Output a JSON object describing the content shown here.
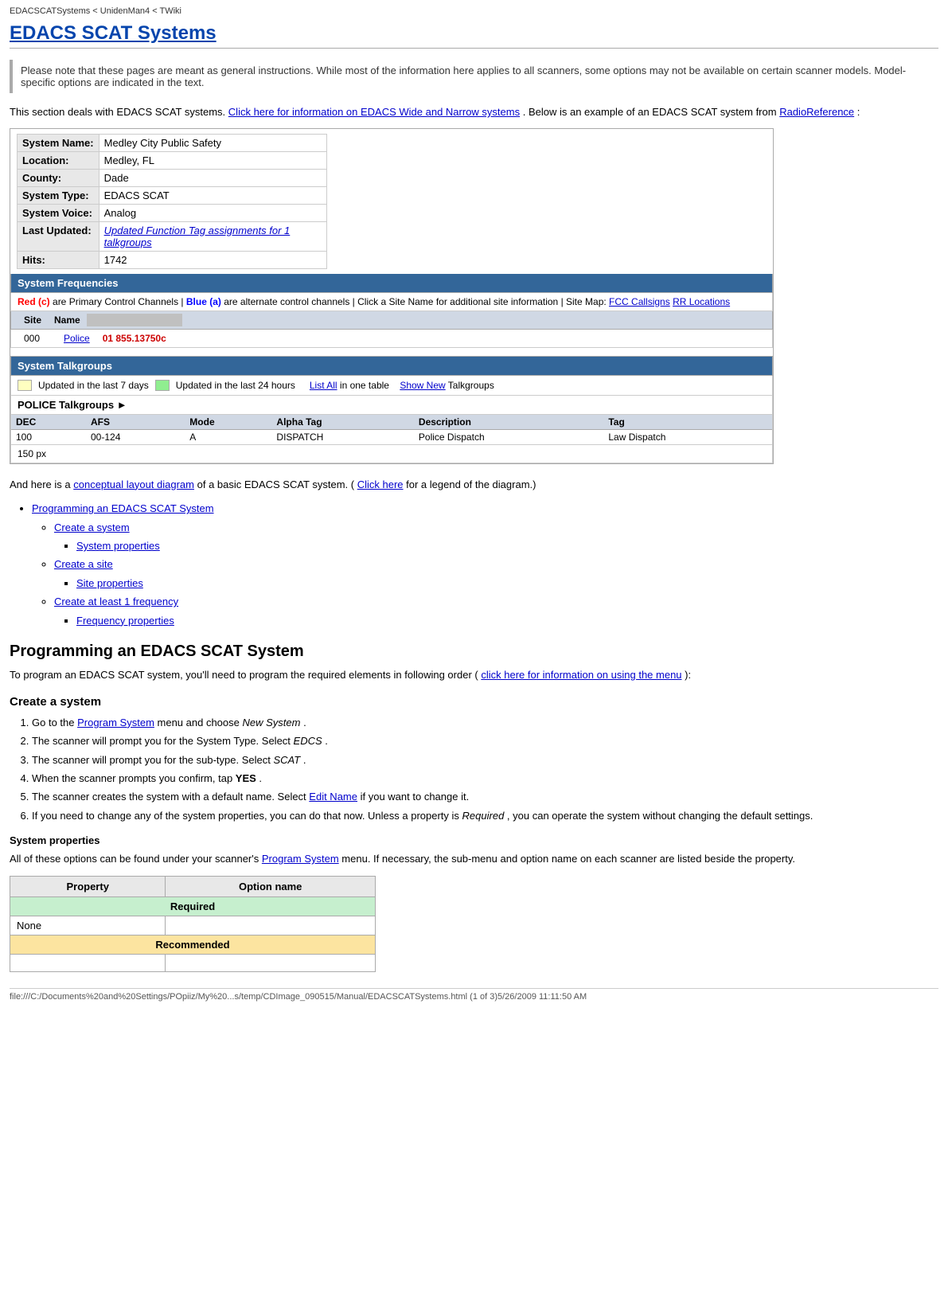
{
  "browser_title": "EDACSCATSystems < UnidenMan4 < TWiki",
  "page_title": "EDACS SCAT Systems",
  "notice": "Please note that these pages are meant as general instructions. While most of the information here applies to all scanners, some options may not be available on certain scanner models. Model-specific options are indicated in the text.",
  "intro_text": "This section deals with EDACS SCAT systems.",
  "intro_link1": "Click here for information on EDACS Wide and Narrow systems",
  "intro_text2": ". Below is an example of an EDACS SCAT system from",
  "intro_link2": "RadioReference",
  "intro_text3": ":",
  "system_info": {
    "rows": [
      {
        "label": "System Name:",
        "value": "Medley City Public Safety"
      },
      {
        "label": "Location:",
        "value": "Medley, FL"
      },
      {
        "label": "County:",
        "value": "Dade"
      },
      {
        "label": "System Type:",
        "value": "EDACS SCAT"
      },
      {
        "label": "System Voice:",
        "value": "Analog"
      },
      {
        "label": "Last Updated:",
        "value": "Updated Function Tag assignments for 1 talkgroups",
        "is_link": true
      },
      {
        "label": "Hits:",
        "value": "1742"
      }
    ]
  },
  "freq_section": {
    "header": "System Frequencies",
    "legend_text1": "Red (c)",
    "legend_text1_after": " are Primary Control Channels | ",
    "legend_text2": "Blue (a)",
    "legend_text2_after": " are alternate control channels | Click a Site Name for additional site information | Site Map:",
    "legend_fcc": "FCC Callsigns",
    "legend_rr": "RR Locations",
    "columns": [
      "Site",
      "Name",
      ""
    ],
    "rows": [
      {
        "site": "000",
        "name": "Police",
        "freq": "01 855.13750c"
      }
    ]
  },
  "tg_section": {
    "header": "System Talkgroups",
    "legend_yellow": "Updated in the last 7 days",
    "legend_green": "Updated in the last 24 hours",
    "list_all": "List All",
    "list_all_after": " in one table",
    "show_new": "Show New",
    "show_new_after": " Talkgroups",
    "group_name": "POLICE Talkgroups",
    "columns": [
      "DEC",
      "AFS",
      "Mode",
      "Alpha Tag",
      "Description",
      "Tag"
    ],
    "rows": [
      {
        "dec": "100",
        "afs": "00-124",
        "mode": "A",
        "alpha": "DISPATCH",
        "desc": "Police Dispatch",
        "tag": "Law Dispatch"
      }
    ],
    "px_label": "150 px"
  },
  "diagram_text": "And here is a",
  "diagram_link": "conceptual layout diagram",
  "diagram_text2": "of a basic EDACS SCAT system. (",
  "diagram_link2": "Click here",
  "diagram_text3": " for a legend of the diagram.)",
  "toc": {
    "items": [
      {
        "label": "Programming an EDACS SCAT System",
        "link": true,
        "children": [
          {
            "label": "Create a system",
            "link": true,
            "children": [
              {
                "label": "System properties",
                "link": true
              }
            ]
          },
          {
            "label": "Create a site",
            "link": true,
            "children": [
              {
                "label": "Site properties",
                "link": true
              }
            ]
          },
          {
            "label": "Create at least 1 frequency",
            "link": true,
            "children": [
              {
                "label": "Frequency properties",
                "link": true
              }
            ]
          }
        ]
      }
    ]
  },
  "prog_section": {
    "heading": "Programming an EDACS SCAT System",
    "intro": "To program an EDACS SCAT system, you'll need to program the required elements in following order (",
    "intro_link": "click here for information on using the menu",
    "intro_end": "):",
    "create_system": {
      "heading": "Create a system",
      "steps": [
        {
          "text": "Go to the ",
          "link": "Program System",
          "after": " menu and choose New System ."
        },
        {
          "text": "The scanner will prompt you for the System Type. Select EDCS ."
        },
        {
          "text": "The scanner will prompt you for the sub-type. Select SCAT ."
        },
        {
          "text": "When the scanner prompts you confirm, tap YES ."
        },
        {
          "text": "The scanner creates the system with a default name. Select ",
          "link": "Edit Name",
          "after": " if you want to change it."
        },
        {
          "text": "If you need to change any of the system properties, you can do that now. Unless a property is Required , you can operate the system without changing the default settings."
        }
      ]
    },
    "sys_props": {
      "heading": "System properties",
      "intro": "All of these options can be found under your scanner's ",
      "link": "Program System",
      "after": " menu. If necessary, the sub-menu and option name on each scanner are listed beside the property.",
      "table": {
        "col1": "Property",
        "col2": "Option name",
        "required_label": "Required",
        "none_label": "None",
        "recommended_label": "Recommended",
        "empty_rows": 1
      }
    }
  },
  "status_bar": "file:///C:/Documents%20and%20Settings/POpiiz/My%20...s/temp/CDImage_090515/Manual/EDACSCATSystems.html (1 of 3)5/26/2009 11:11:50 AM"
}
